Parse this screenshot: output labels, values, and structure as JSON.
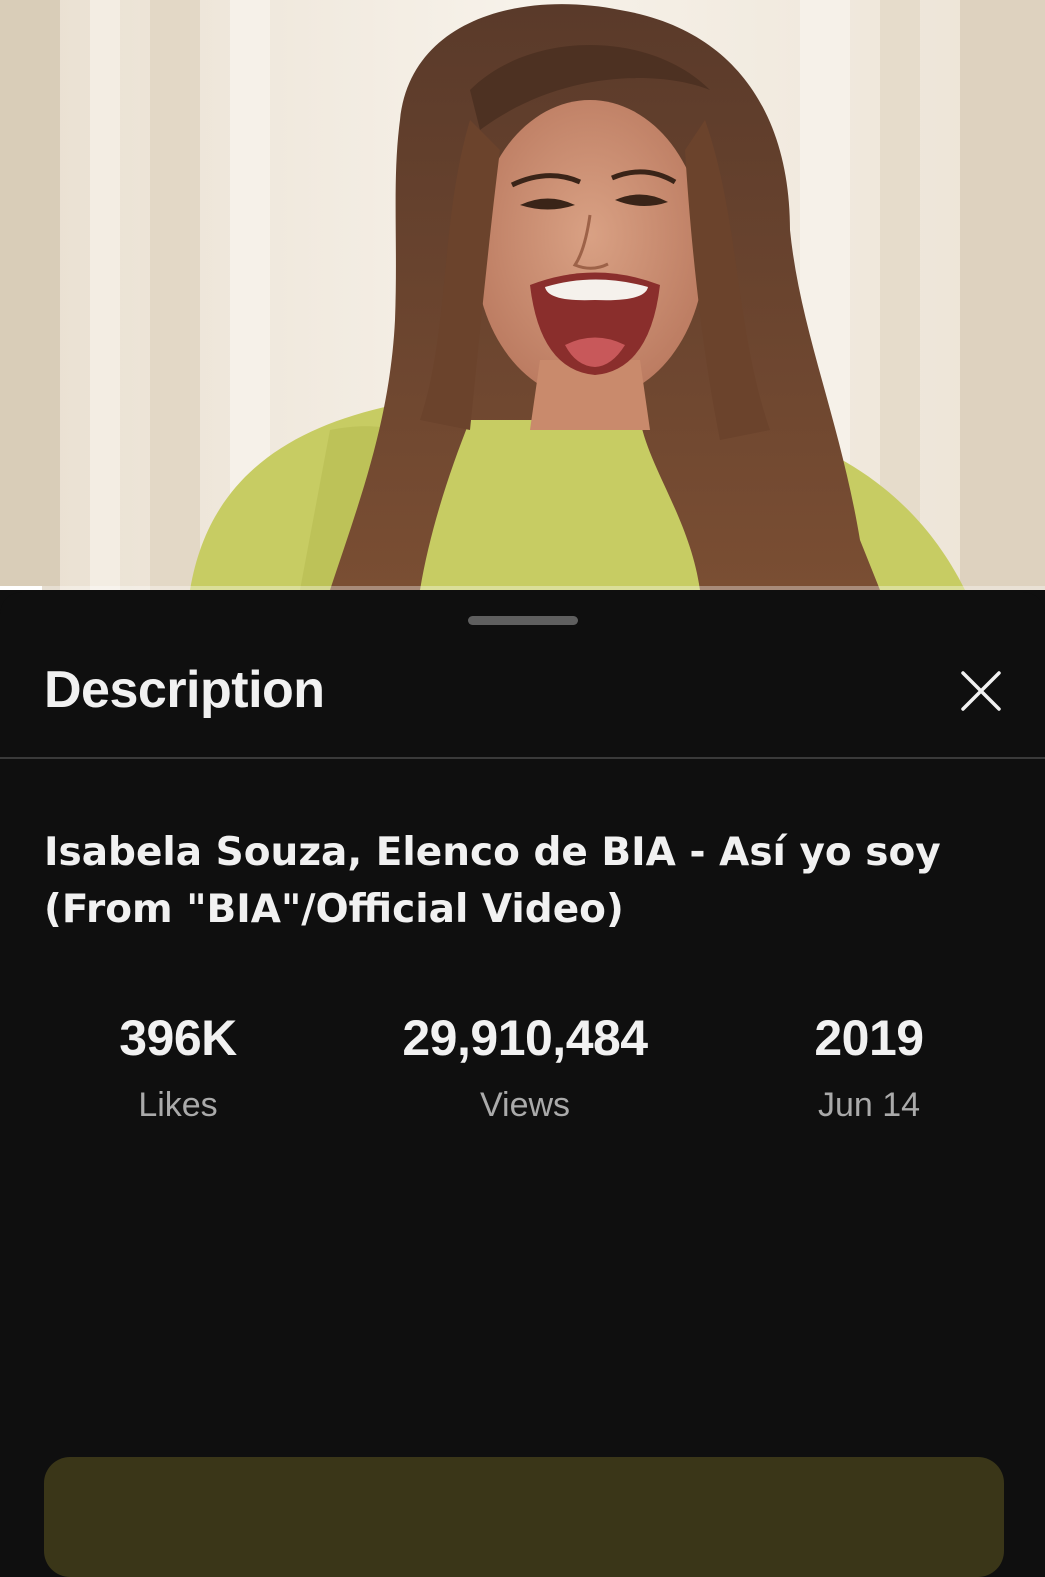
{
  "player": {
    "progress_percent": 4
  },
  "description_panel": {
    "heading": "Description",
    "close_label": "Close"
  },
  "video": {
    "title": "Isabela Souza, Elenco de BIA - Así yo soy (From \"BIA\"/Official Video)"
  },
  "stats": {
    "likes": {
      "value": "396K",
      "label": "Likes"
    },
    "views": {
      "value": "29,910,484",
      "label": "Views"
    },
    "date": {
      "value": "2019",
      "label": "Jun 14"
    }
  },
  "colors": {
    "background": "#0f0f0f",
    "text_primary": "#f1f1f1",
    "text_secondary": "#aaaaaa",
    "card_tint": "#3a3618"
  }
}
